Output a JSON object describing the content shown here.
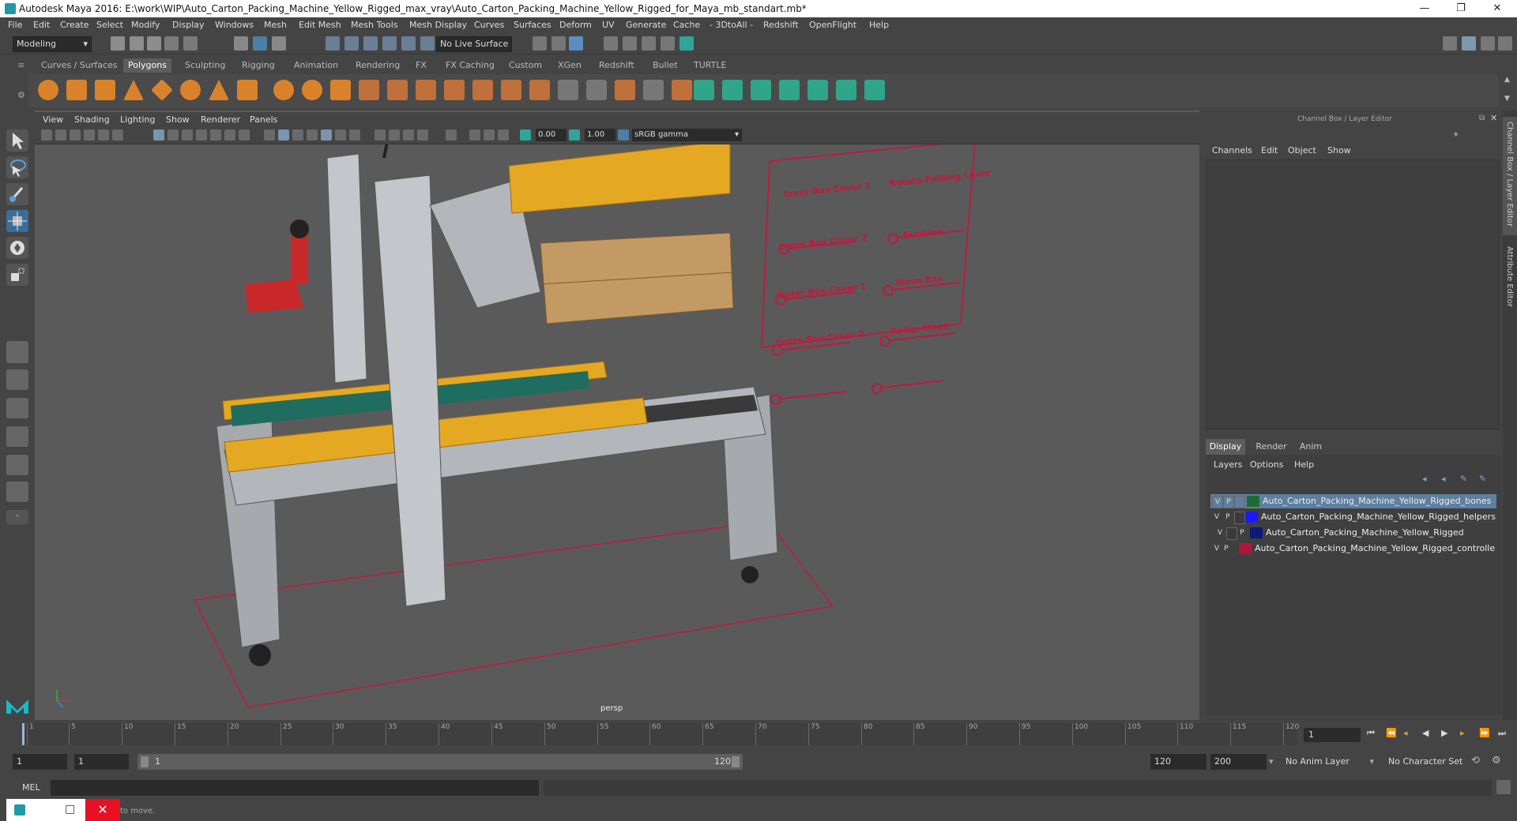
{
  "window": {
    "title": "Autodesk Maya 2016: E:\\work\\WIP\\Auto_Carton_Packing_Machine_Yellow_Rigged_max_vray\\Auto_Carton_Packing_Machine_Yellow_Rigged_for_Maya_mb_standart.mb*",
    "controls": [
      "—",
      "❐",
      "✕"
    ]
  },
  "menubar": [
    "File",
    "Edit",
    "Create",
    "Select",
    "Modify",
    "Display",
    "Windows",
    "Mesh",
    "Edit Mesh",
    "Mesh Tools",
    "Mesh Display",
    "Curves",
    "Surfaces",
    "Deform",
    "UV",
    "Generate",
    "Cache",
    "- 3DtoAll -",
    "Redshift",
    "OpenFlight",
    "Help"
  ],
  "statusline": {
    "mode": "Modeling",
    "live_surface": "No Live Surface"
  },
  "shelf": {
    "tabs": [
      "Curves / Surfaces",
      "Polygons",
      "Sculpting",
      "Rigging",
      "Animation",
      "Rendering",
      "FX",
      "FX Caching",
      "Custom",
      "XGen",
      "Redshift",
      "Bullet",
      "TURTLE"
    ],
    "active_tab": "Polygons"
  },
  "viewport": {
    "menus": [
      "View",
      "Shading",
      "Lighting",
      "Show",
      "Renderer",
      "Panels"
    ],
    "exposure": "0.00",
    "gamma": "1.00",
    "color_space": "sRGB gamma",
    "camera_label": "persp",
    "controller_labels": [
      "Inner Box Cover 1",
      "Rotate Folding Lever",
      "Inner Box Cover 2",
      "Fixation",
      "Outer Box Cover 1",
      "Move Box",
      "Outre Box Cover 2",
      "Roller Move"
    ]
  },
  "channel_box": {
    "title": "Channel Box / Layer Editor",
    "menus": [
      "Channels",
      "Edit",
      "Object",
      "Show"
    ],
    "side_tabs": [
      "Channel Box / Layer Editor",
      "Attribute Editor"
    ]
  },
  "layer_editor": {
    "tabs": [
      "Display",
      "Render",
      "Anim"
    ],
    "active_tab": "Display",
    "menus": [
      "Layers",
      "Options",
      "Help"
    ],
    "layers": [
      {
        "v": "V",
        "p": "P",
        "color": "#1d6b3a",
        "name": "Auto_Carton_Packing_Machine_Yellow_Rigged_bones",
        "selected": true
      },
      {
        "v": "V",
        "p": "P",
        "color": "#1a1aff",
        "name": "Auto_Carton_Packing_Machine_Yellow_Rigged_helpers",
        "selected": false
      },
      {
        "v": "V",
        "p": "P",
        "color": "#0d1a7a",
        "name": "Auto_Carton_Packing_Machine_Yellow_Rigged",
        "selected": false
      },
      {
        "v": "V",
        "p": "P",
        "color": "#b0153a",
        "name": "Auto_Carton_Packing_Machine_Yellow_Rigged_controlle",
        "selected": false
      }
    ]
  },
  "timeline": {
    "ticks": [
      "1",
      "5",
      "10",
      "15",
      "20",
      "25",
      "30",
      "35",
      "40",
      "45",
      "50",
      "55",
      "60",
      "65",
      "70",
      "75",
      "80",
      "85",
      "90",
      "95",
      "100",
      "105",
      "110",
      "115",
      "120"
    ],
    "current_frame": "1"
  },
  "range": {
    "start": "1",
    "anim_start": "1",
    "slider_start": "1",
    "slider_end": "120",
    "end": "120",
    "anim_end": "200",
    "anim_layer": "No Anim Layer",
    "character_set": "No Character Set"
  },
  "command": {
    "label": "MEL",
    "help": "to move."
  }
}
